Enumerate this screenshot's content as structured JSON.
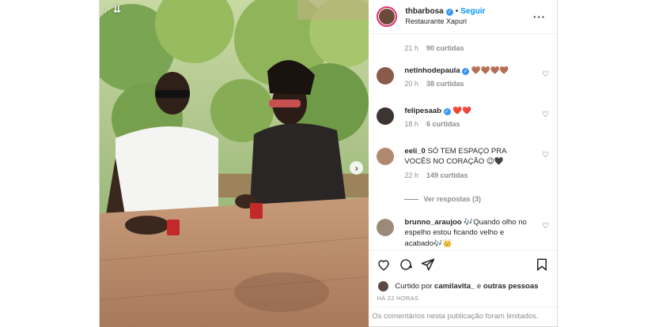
{
  "post": {
    "download_icons": [
      "↓",
      "⇊"
    ],
    "next_arrow": "›",
    "author": "thbarbosa",
    "follow_label": "Seguir",
    "separator": "•",
    "location": "Restaurante Xapuri",
    "more_label": "···",
    "time_ago": "HÁ 22 HORAS",
    "comments_limited": "Os comentários nesta publicação foram limitados.",
    "liked_by_prefix": "Curtido por",
    "liked_by_user": "camilavita_",
    "liked_by_and": "e",
    "liked_by_others": "outras pessoas"
  },
  "first_meta": {
    "time": "21 h",
    "likes": "90 curtidas"
  },
  "comments": [
    {
      "user": "netinhodepaula",
      "verified": true,
      "text": "🤎🤎🤎🤎",
      "time": "20 h",
      "likes": "38 curtidas"
    },
    {
      "user": "felipesaab",
      "verified": true,
      "text": "❤️❤️",
      "time": "18 h",
      "likes": "6 curtidas"
    },
    {
      "user": "eeli_0",
      "verified": false,
      "text": "SÓ TEM ESPAÇO PRA VOCÊS NO CORAÇÃO 😉🖤",
      "time": "22 h",
      "likes": "149 curtidas",
      "replies": "Ver respostas (3)"
    },
    {
      "user": "brunno_araujoo",
      "verified": false,
      "text": "🎶Quando olho no espelho estou ficando velho e acabado🎶👑"
    }
  ],
  "colors": {
    "accent": "#0095f6",
    "verified": "#3897f0",
    "story_ring": "#e0306f",
    "muted": "#8e8e8e"
  }
}
